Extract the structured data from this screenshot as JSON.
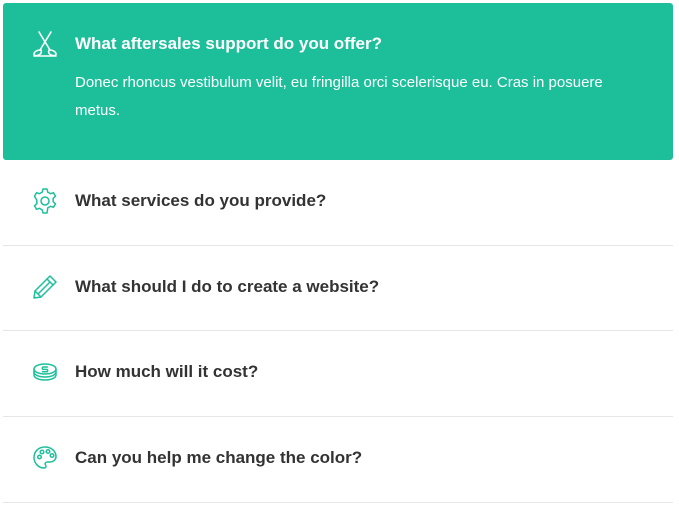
{
  "faq": {
    "items": [
      {
        "icon": "scissors-icon",
        "question": "What aftersales support do you offer?",
        "answer": "Donec rhoncus vestibulum velit, eu fringilla orci scelerisque eu. Cras in posuere metus.",
        "expanded": true
      },
      {
        "icon": "gear-icon",
        "question": "What services do you provide?",
        "expanded": false
      },
      {
        "icon": "pencil-icon",
        "question": "What should I do to create a website?",
        "expanded": false
      },
      {
        "icon": "coin-stack-icon",
        "question": "How much will it cost?",
        "expanded": false
      },
      {
        "icon": "palette-icon",
        "question": "Can you help me change the color?",
        "expanded": false
      }
    ]
  },
  "colors": {
    "accent": "#1dbf9b",
    "icon": "#1dbf9b",
    "text": "#333333",
    "divider": "#e6e6e6"
  }
}
